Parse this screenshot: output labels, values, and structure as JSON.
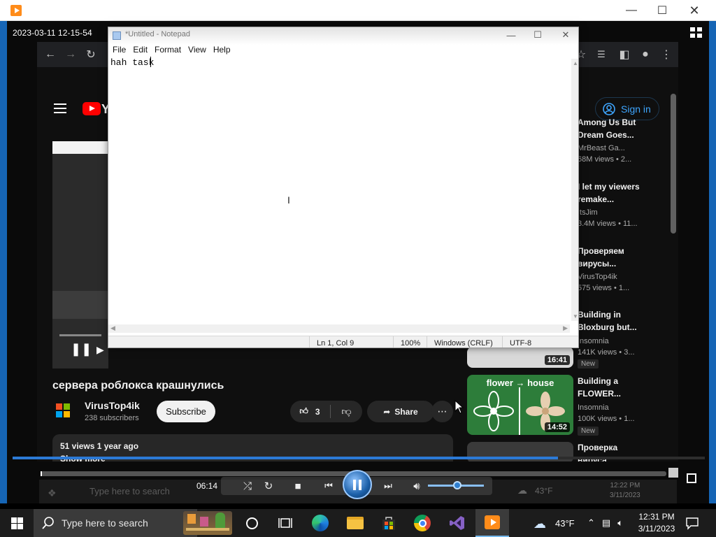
{
  "media_player": {
    "timestamp": "2023-03-11 12-15-54",
    "current_time": "06:14",
    "colors": {
      "accent": "#2c7ad6",
      "titlebar": "#ffffff"
    }
  },
  "browser": {
    "nav": [
      "back",
      "forward",
      "reload"
    ]
  },
  "youtube": {
    "logo_text": "Y",
    "signin_label": "Sign in",
    "video_title": "сервера роблокса крашнулись",
    "channel_name": "VirusTop4ik",
    "channel_subs": "238 subscribers",
    "subscribe_label": "Subscribe",
    "like_count": "3",
    "share_label": "Share",
    "desc_meta": "51 views  1 year ago",
    "desc_more": "Show more",
    "recommendations": [
      {
        "title": "Among Us But Dream Goes...",
        "channel": "MrBeast Ga...",
        "views": "68M views • 2..."
      },
      {
        "title": "I let my viewers remake...",
        "channel": "ItsJim",
        "views": "3.4M views • 11..."
      },
      {
        "title": "Проверяем вирусы...",
        "channel": "VirusTop4ik",
        "views": "575 views • 1..."
      },
      {
        "title": "Building in Bloxburg but...",
        "channel": "Insomnia",
        "views": "141K views • 3...",
        "badge": "New",
        "duration": "16:41"
      },
      {
        "title": "Building a FLOWER...",
        "channel": "Insomnia",
        "views": "100K views • 1...",
        "badge": "New",
        "duration": "14:52",
        "thumb_text": "flower → house"
      },
      {
        "title": "Проверка вируса..."
      }
    ]
  },
  "notepad": {
    "title": "*Untitled - Notepad",
    "menu": [
      "File",
      "Edit",
      "Format",
      "View",
      "Help"
    ],
    "content": "hah task",
    "status": {
      "position": "Ln 1, Col 9",
      "zoom": "100%",
      "eol": "Windows (CRLF)",
      "encoding": "UTF-8"
    }
  },
  "ghost_taskbar": {
    "search": "Type here to search",
    "weather": "43°F",
    "time": "12:22 PM",
    "date": "3/11/2023"
  },
  "taskbar": {
    "search_placeholder": "Type here to search",
    "weather_temp": "43°F",
    "time": "12:31 PM",
    "date": "3/11/2023",
    "apps": [
      "widgets",
      "cortana-circle",
      "task-view",
      "edge",
      "file-explorer",
      "store",
      "chrome",
      "visual-studio",
      "media-player"
    ]
  }
}
